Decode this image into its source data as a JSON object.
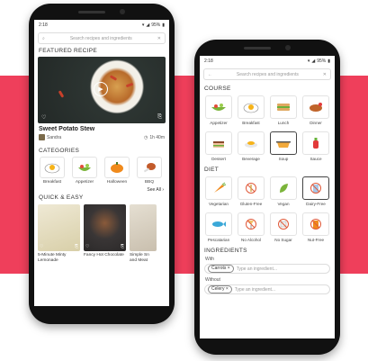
{
  "left_phone": {
    "status": {
      "time": "2:18",
      "battery": "95%"
    },
    "search": {
      "placeholder": "Search recipes and ingredients"
    },
    "featured": {
      "heading": "FEATURED RECIPE",
      "recipe_name": "Sweet Potato Stew",
      "author": "Sandra",
      "duration": "1h 40m"
    },
    "categories": {
      "heading": "CATEGORIES",
      "items": [
        {
          "label": "Breakfast",
          "icon": "fried-egg-icon"
        },
        {
          "label": "Appetizer",
          "icon": "salad-bowl-icon"
        },
        {
          "label": "Halloween",
          "icon": "pumpkin-icon"
        },
        {
          "label": "BBQ",
          "icon": "drumstick-icon"
        }
      ],
      "see_all": "See All ›"
    },
    "quick_easy": {
      "heading": "QUICK & EASY",
      "items": [
        {
          "label": "5-Minute Minty Lemonade",
          "color": "#e8e3cf"
        },
        {
          "label": "Fancy Hot Chocolate",
          "color": "#3a3636"
        },
        {
          "label": "Simple Sn and Meat",
          "color": "#d9d2c4"
        }
      ]
    }
  },
  "right_phone": {
    "status": {
      "time": "2:18",
      "battery": "95%"
    },
    "search": {
      "placeholder": "Search recipes and ingredients"
    },
    "course": {
      "heading": "COURSE",
      "items": [
        {
          "label": "Appetizer",
          "icon": "salad-bowl-icon",
          "selected": false
        },
        {
          "label": "Breakfast",
          "icon": "fried-egg-icon",
          "selected": false
        },
        {
          "label": "Lunch",
          "icon": "sandwich-icon",
          "selected": false
        },
        {
          "label": "Dinner",
          "icon": "roast-chicken-icon",
          "selected": false
        },
        {
          "label": "Dessert",
          "icon": "cake-icon",
          "selected": false
        },
        {
          "label": "Beverage",
          "icon": "coffee-cup-icon",
          "selected": false
        },
        {
          "label": "Soup",
          "icon": "soup-pot-icon",
          "selected": true
        },
        {
          "label": "Sauce",
          "icon": "ketchup-bottle-icon",
          "selected": false
        }
      ]
    },
    "diet": {
      "heading": "DIET",
      "items": [
        {
          "label": "Vegetarian",
          "icon": "carrot-icon",
          "selected": false
        },
        {
          "label": "Gluten-Free",
          "icon": "no-wheat-icon",
          "selected": false
        },
        {
          "label": "Vegan",
          "icon": "leaf-icon",
          "selected": false
        },
        {
          "label": "Dairy-Free",
          "icon": "no-milk-icon",
          "selected": true
        },
        {
          "label": "Pescatarian",
          "icon": "fish-icon",
          "selected": false
        },
        {
          "label": "No Alcohol",
          "icon": "no-alcohol-icon",
          "selected": false
        },
        {
          "label": "No Sugar",
          "icon": "no-sugar-icon",
          "selected": false
        },
        {
          "label": "Nut-Free",
          "icon": "no-nut-icon",
          "selected": false
        }
      ]
    },
    "ingredients": {
      "heading": "INGREDIENTS",
      "with_label": "With",
      "with_chip": "Carrots ×",
      "with_placeholder": "Type an ingredient...",
      "without_label": "Without",
      "without_chip": "Celery ×",
      "without_placeholder": "Type an ingredient..."
    }
  },
  "colors": {
    "accent_band": "#ef3f5b",
    "phone_body": "#111111"
  }
}
